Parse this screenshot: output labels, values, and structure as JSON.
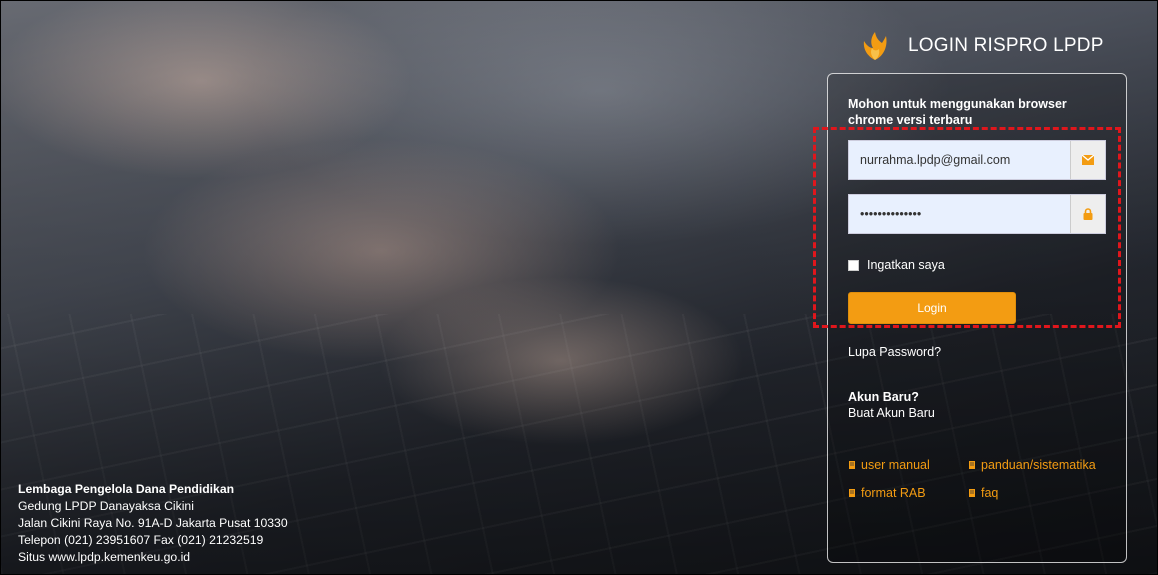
{
  "header": {
    "title": "LOGIN RISPRO LPDP",
    "logo_icon": "lpdp-flame-logo"
  },
  "login": {
    "notice": "Mohon untuk menggunakan browser chrome versi terbaru",
    "email_value": "nurrahma.lpdp@gmail.com",
    "password_mask": "••••••••••••••",
    "email_icon": "envelope-icon",
    "password_icon": "lock-icon",
    "remember_label": "Ingatkan saya",
    "remember_checked": false,
    "login_label": "Login",
    "forgot_label": "Lupa Password?",
    "new_account_title": "Akun Baru?",
    "new_account_link": "Buat Akun Baru"
  },
  "docs": {
    "user_manual": "user manual",
    "panduan": "panduan/sistematika",
    "format_rab": "format RAB",
    "faq": "faq",
    "icon": "book-icon"
  },
  "org": {
    "name": "Lembaga Pengelola Dana Pendidikan",
    "building": "Gedung LPDP Danayaksa Cikini",
    "address": "Jalan Cikini Raya No. 91A-D Jakarta Pusat 10330",
    "phone": "Telepon (021) 23951607 Fax (021) 21232519",
    "site": "Situs www.lpdp.kemenkeu.go.id"
  },
  "colors": {
    "accent": "#f39c12",
    "highlight": "#e0161c"
  }
}
